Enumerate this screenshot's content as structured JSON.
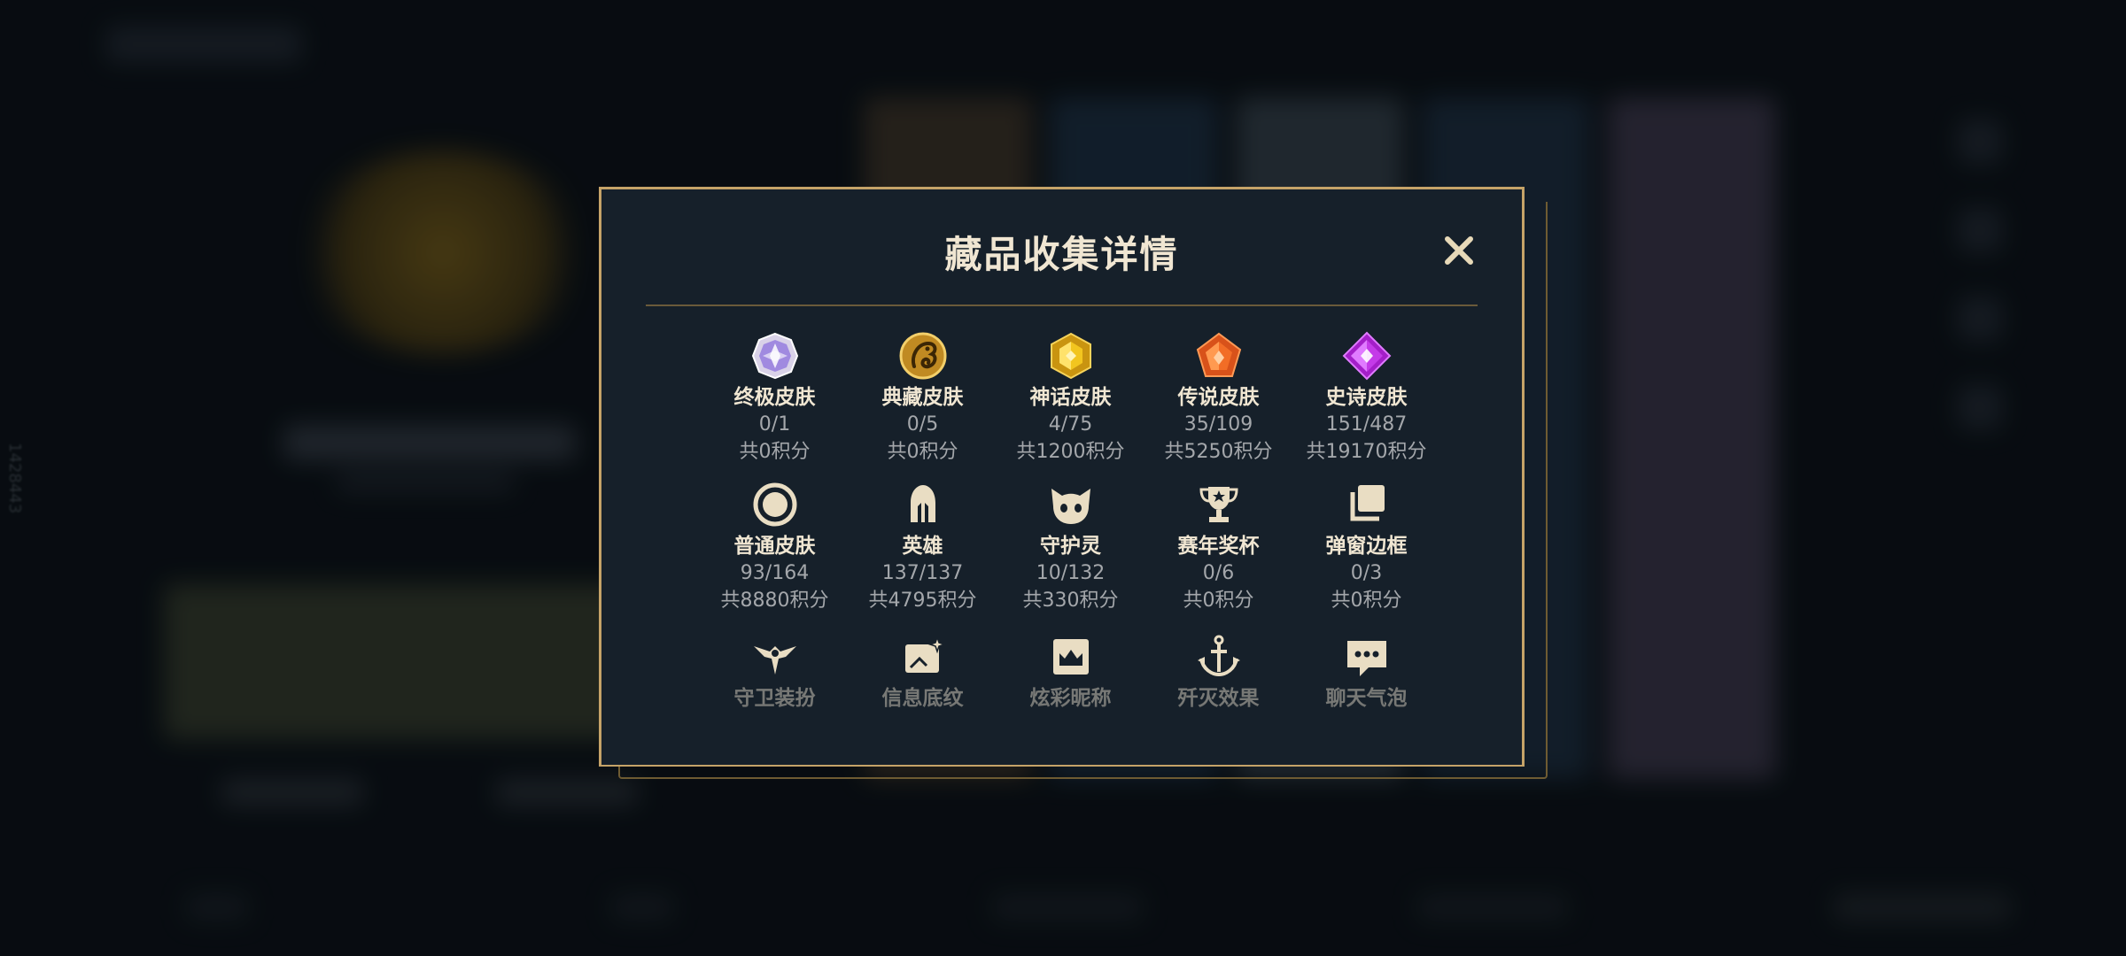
{
  "background": {
    "side_id": "1428443"
  },
  "dialog": {
    "title": "藏品收集详情",
    "items": [
      {
        "name": "终极皮肤",
        "count": "0/1",
        "points": "共0积分",
        "icon": "ultimate-gem-icon"
      },
      {
        "name": "典藏皮肤",
        "count": "0/5",
        "points": "共0积分",
        "icon": "dragon-coin-icon"
      },
      {
        "name": "神话皮肤",
        "count": "4/75",
        "points": "共1200积分",
        "icon": "mythic-gem-icon"
      },
      {
        "name": "传说皮肤",
        "count": "35/109",
        "points": "共5250积分",
        "icon": "legendary-gem-icon"
      },
      {
        "name": "史诗皮肤",
        "count": "151/487",
        "points": "共19170积分",
        "icon": "epic-gem-icon"
      },
      {
        "name": "普通皮肤",
        "count": "93/164",
        "points": "共8880积分",
        "icon": "ring-icon"
      },
      {
        "name": "英雄",
        "count": "137/137",
        "points": "共4795积分",
        "icon": "helmet-icon"
      },
      {
        "name": "守护灵",
        "count": "10/132",
        "points": "共330积分",
        "icon": "cat-face-icon"
      },
      {
        "name": "赛年奖杯",
        "count": "0/6",
        "points": "共0积分",
        "icon": "trophy-icon"
      },
      {
        "name": "弹窗边框",
        "count": "0/3",
        "points": "共0积分",
        "icon": "stacked-frames-icon"
      },
      {
        "name": "守卫装扮",
        "icon": "ward-icon"
      },
      {
        "name": "信息底纹",
        "icon": "card-sparkle-icon"
      },
      {
        "name": "炫彩昵称",
        "icon": "crown-badge-icon"
      },
      {
        "name": "歼灭效果",
        "icon": "anchor-icon"
      },
      {
        "name": "聊天气泡",
        "icon": "chat-bubble-icon"
      }
    ]
  },
  "colors": {
    "gold_border": "#c5a368",
    "title_text": "#f0e6d2",
    "muted_text": "#a4a7ab",
    "dialog_bg": "#16202a"
  }
}
